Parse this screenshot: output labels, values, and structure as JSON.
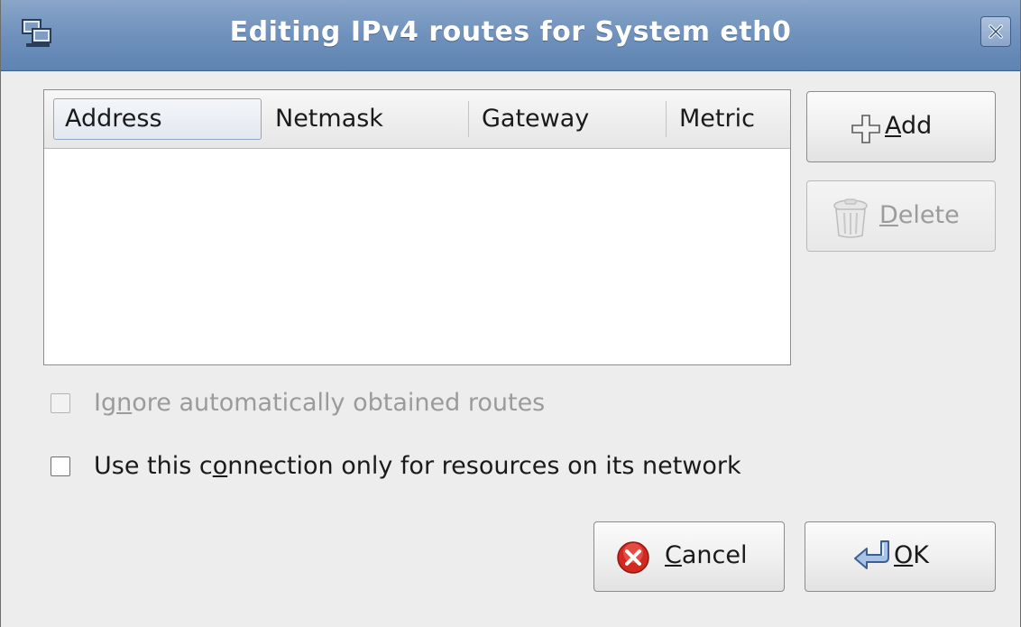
{
  "window": {
    "title": "Editing IPv4 routes for System eth0",
    "icon": "network-connection-icon",
    "close_icon": "close-icon"
  },
  "table": {
    "columns": [
      "Address",
      "Netmask",
      "Gateway",
      "Metric"
    ],
    "rows": []
  },
  "side_buttons": {
    "add": {
      "underline": "A",
      "rest": "dd",
      "icon": "plus-icon",
      "enabled": true
    },
    "delete": {
      "underline": "D",
      "rest": "elete",
      "icon": "trash-icon",
      "enabled": false
    }
  },
  "options": {
    "ignore_auto_routes": {
      "before": "Ig",
      "underline": "n",
      "after": "ore automatically obtained routes",
      "checked": false,
      "enabled": false
    },
    "only_local_resources": {
      "before": "Use this c",
      "underline": "o",
      "after": "nnection only for resources on its network",
      "checked": false,
      "enabled": true
    }
  },
  "footer_buttons": {
    "cancel": {
      "underline": "C",
      "rest": "ancel",
      "icon": "cancel-icon"
    },
    "ok": {
      "underline": "O",
      "rest": "K",
      "icon": "ok-return-arrow-icon"
    }
  },
  "colors": {
    "titlebar": "#7193bd",
    "dialog_bg": "#ededed",
    "cancel_icon": "#d4281f"
  }
}
